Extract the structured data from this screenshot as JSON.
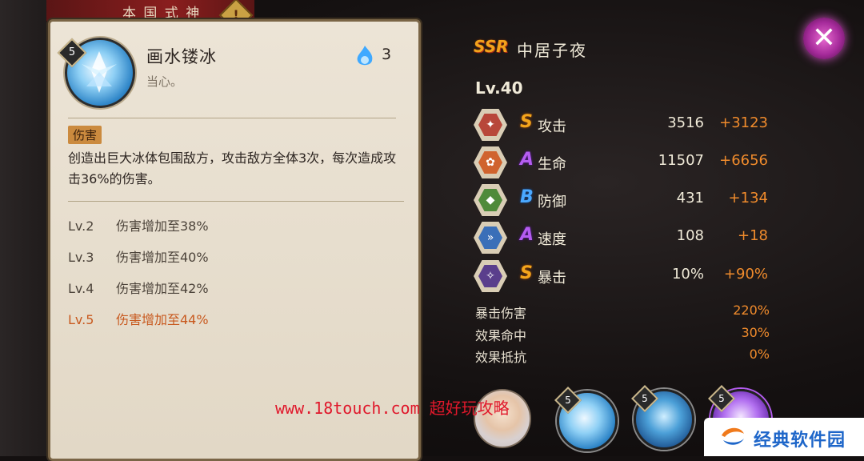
{
  "banner": {
    "title": "本 国 式 神",
    "badge": "!"
  },
  "skill": {
    "level_badge": "5",
    "name": "画水镂冰",
    "description": "当心。",
    "cost": "3",
    "tag": "伤害",
    "text": "创造出巨大冰体包围敌方，攻击敌方全体3次，每次造成攻击36%的伤害。",
    "levels": [
      {
        "lv": "Lv.2",
        "effect": "伤害增加至38%",
        "active": false
      },
      {
        "lv": "Lv.3",
        "effect": "伤害增加至40%",
        "active": false
      },
      {
        "lv": "Lv.4",
        "effect": "伤害增加至42%",
        "active": false
      },
      {
        "lv": "Lv.5",
        "effect": "伤害增加至44%",
        "active": true
      }
    ]
  },
  "shikigami": {
    "rarity": "SSR",
    "name": "中居子夜",
    "level": "Lv.40",
    "stats": [
      {
        "icon": "fan-icon",
        "grade": "S",
        "label": "攻击",
        "value": "3516",
        "bonus": "+3123"
      },
      {
        "icon": "charm-icon",
        "grade": "A",
        "label": "生命",
        "value": "11507",
        "bonus": "+6656"
      },
      {
        "icon": "armor-icon",
        "grade": "B",
        "label": "防御",
        "value": "431",
        "bonus": "+134"
      },
      {
        "icon": "speed-icon",
        "grade": "A",
        "label": "速度",
        "value": "108",
        "bonus": "+18"
      },
      {
        "icon": "crit-icon",
        "grade": "S",
        "label": "暴击",
        "value": "10%",
        "bonus": "+90%"
      }
    ],
    "sub_stats": [
      {
        "label": "暴击伤害",
        "value": "220%"
      },
      {
        "label": "效果命中",
        "value": "30%"
      },
      {
        "label": "效果抵抗",
        "value": "0%"
      }
    ]
  },
  "skill_slots": [
    "5",
    "5",
    "5"
  ],
  "watermark": "www.18touch.com 超好玩攻略",
  "logo": {
    "text": "经典软件园"
  },
  "colors": {
    "accent_orange": "#f08b2c",
    "ssr_gold": "#f2a31c",
    "active_level": "#c8591e"
  }
}
